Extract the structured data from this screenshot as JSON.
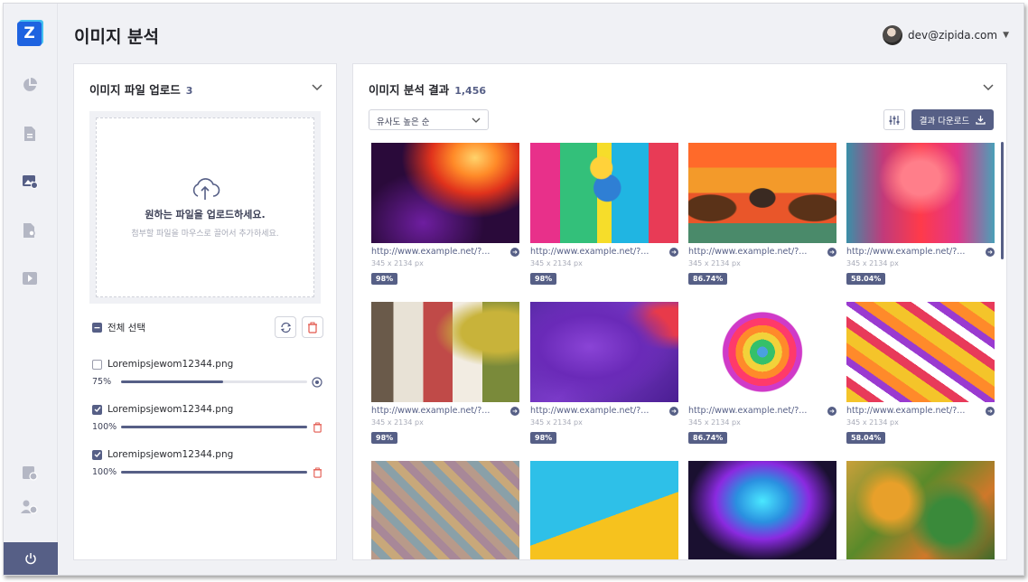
{
  "app": {
    "logo_letter": "Z",
    "page_title": "이미지 분석"
  },
  "user": {
    "email": "dev@zipida.com"
  },
  "sidebar": {
    "items": [
      {
        "icon": "pie-chart-icon"
      },
      {
        "icon": "document-icon"
      },
      {
        "icon": "image-analysis-icon"
      },
      {
        "icon": "file-search-icon"
      },
      {
        "icon": "video-icon"
      },
      {
        "icon": "settings-doc-icon"
      },
      {
        "icon": "users-settings-icon"
      },
      {
        "icon": "power-icon"
      }
    ]
  },
  "upload_panel": {
    "title": "이미지 파일 업로드",
    "count": "3",
    "dropzone_title": "원하는 파일을 업로드하세요.",
    "dropzone_sub": "첨부할 파일을 마우스로 끌어서 추가하세요.",
    "select_all": "전체 선택",
    "files": [
      {
        "name": "Loremipsjewom12344.png",
        "checked": false,
        "progress": "75%",
        "progress_value": 0.55
      },
      {
        "name": "Loremipsjewom12344.png",
        "checked": true,
        "progress": "100%",
        "progress_value": 1.0
      },
      {
        "name": "Loremipsjewom12344.png",
        "checked": true,
        "progress": "100%",
        "progress_value": 1.0
      }
    ]
  },
  "results_panel": {
    "title": "이미지 분석 결과",
    "count": "1,456",
    "sort_label": "유사도 높은 순",
    "download_label": "결과 다운로드",
    "cards": [
      {
        "url": "http://www.example.net/?...",
        "size": "345 x 2134 px",
        "score": "98%"
      },
      {
        "url": "http://www.example.net/?...",
        "size": "345 x 2134 px",
        "score": "98%"
      },
      {
        "url": "http://www.example.net/?...",
        "size": "345 x 2134 px",
        "score": "86.74%"
      },
      {
        "url": "http://www.example.net/?...",
        "size": "345 x 2134 px",
        "score": "58.04%"
      },
      {
        "url": "http://www.example.net/?...",
        "size": "345 x 2134 px",
        "score": "98%"
      },
      {
        "url": "http://www.example.net/?...",
        "size": "345 x 2134 px",
        "score": "98%"
      },
      {
        "url": "http://www.example.net/?...",
        "size": "345 x 2134 px",
        "score": "86.74%"
      },
      {
        "url": "http://www.example.net/?...",
        "size": "345 x 2134 px",
        "score": "58.04%"
      }
    ]
  },
  "colors": {
    "accent": "#565f86",
    "logo": "#1e63e0",
    "danger": "#e2574c"
  }
}
